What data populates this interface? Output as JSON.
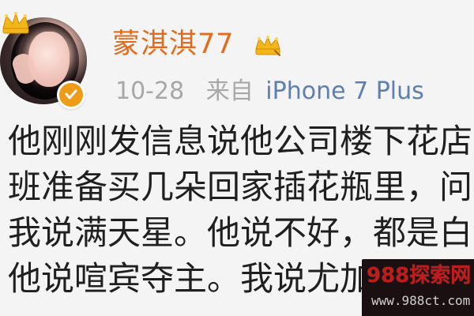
{
  "header": {
    "username": "蒙淇淇77",
    "timestamp": "10-28",
    "source_prefix": "来自",
    "device": "iPhone 7 Plus"
  },
  "post": {
    "lines": [
      "他刚刚发信息说他公司楼下花店洋",
      "班准备买几朵回家插花瓶里，问我",
      "我说满天星。他说不好，都是白色",
      "他说喧宾夺主。我说尤加利"
    ]
  },
  "watermark": {
    "site_name": "988探索网",
    "site_url": "www.988ct.com"
  },
  "icons": {
    "avatar_crown": "crown-icon",
    "verified_badge": "verified-badge-icon",
    "vip": "vip-crown-icon"
  },
  "colors": {
    "username": "#e36b1c",
    "meta_gray": "#a7a7a7",
    "device_link": "#5c7fb0",
    "text": "#1f1f1f",
    "badge_orange": "#f09b16",
    "watermark_red": "#c21b1b"
  }
}
